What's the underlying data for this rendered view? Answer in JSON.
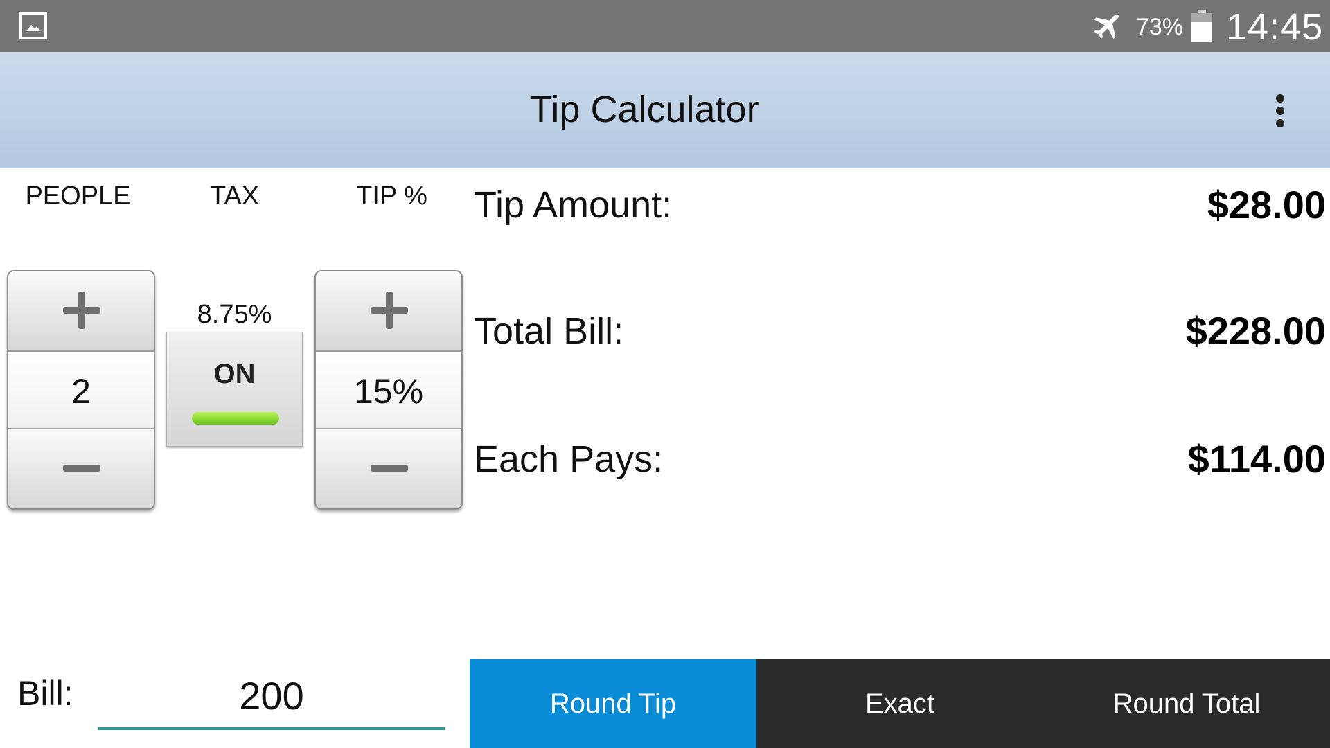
{
  "status_bar": {
    "notification_icon": "image-icon",
    "airplane_icon": "airplane-icon",
    "battery_percent": "73%",
    "battery_icon": "battery-icon",
    "time": "14:45"
  },
  "action_bar": {
    "title": "Tip Calculator",
    "overflow_icon": "more-vert-icon"
  },
  "controls": {
    "people": {
      "label": "PEOPLE",
      "value": "2"
    },
    "tax": {
      "label": "TAX",
      "rate": "8.75%",
      "toggle_label": "ON",
      "toggle_state": "on"
    },
    "tip": {
      "label": "TIP %",
      "value": "15%"
    }
  },
  "results": {
    "tip_amount_label": "Tip Amount:",
    "tip_amount_value": "$28.00",
    "total_bill_label": "Total Bill:",
    "total_bill_value": "$228.00",
    "each_pays_label": "Each Pays:",
    "each_pays_value": "$114.00"
  },
  "bill": {
    "label": "Bill:",
    "value": "200"
  },
  "rounding": {
    "options": [
      "Round Tip",
      "Exact",
      "Round Total"
    ],
    "selected": "Round Tip"
  },
  "colors": {
    "status_bar": "#757575",
    "action_bar": "#c2d5ea",
    "active_round": "#0a8bd6",
    "round_bar": "#2b2b2b",
    "input_underline": "#2f9a97",
    "toggle_on": "#8ee03a"
  }
}
